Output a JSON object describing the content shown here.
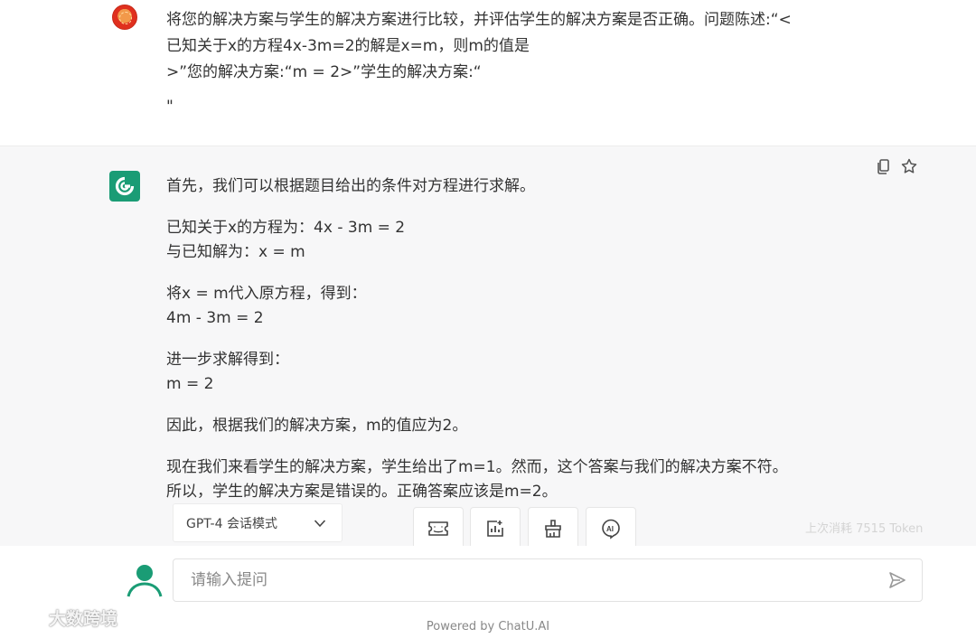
{
  "user_message": {
    "lines": [
      "将您的解决方案与学生的解决方案进行比较，并评估学生的解决方案是否正确。问题陈述:“<",
      "已知关于x的方程4x-3m=2的解是x=m，则m的值是",
      ">”您的解决方案:“m = 2>”学生的解决方案:“"
    ],
    "quote": "\""
  },
  "assistant_message": {
    "paragraphs": [
      [
        "首先，我们可以根据题目给出的条件对方程进行求解。"
      ],
      [
        "已知关于x的方程为：4x - 3m = 2",
        "与已知解为：x = m"
      ],
      [
        "将x = m代入原方程，得到：",
        "4m - 3m = 2"
      ],
      [
        "进一步求解得到：",
        "m = 2"
      ],
      [
        "因此，根据我们的解决方案，m的值应为2。"
      ],
      [
        "现在我们来看学生的解决方案，学生给出了m=1。然而，这个答案与我们的解决方案不符。",
        "所以，学生的解决方案是错误的。正确答案应该是m=2。"
      ]
    ]
  },
  "toolbar": {
    "mode_label": "GPT-4 会话模式",
    "token_info": "上次消耗 7515 Token"
  },
  "input": {
    "placeholder": "请输入提问"
  },
  "footer": {
    "powered_by": "Powered by ChatU.AI",
    "watermark": "大数跨境"
  },
  "icons": {
    "copy": "copy-icon",
    "star": "star-icon",
    "ticket": "ticket-icon",
    "chart": "chart-icon",
    "broom": "broom-icon",
    "ai": "ai-icon",
    "send": "send-icon",
    "chevron": "chevron-down-icon"
  },
  "colors": {
    "brand_green": "#1a9c75",
    "assistant_bg": "#f7f7f8"
  }
}
